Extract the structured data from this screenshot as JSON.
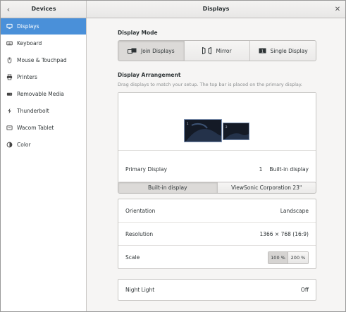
{
  "header": {
    "left_title": "Devices",
    "main_title": "Displays"
  },
  "sidebar": {
    "items": [
      {
        "label": "Displays",
        "icon": "display-icon",
        "active": true
      },
      {
        "label": "Keyboard",
        "icon": "keyboard-icon",
        "active": false
      },
      {
        "label": "Mouse & Touchpad",
        "icon": "mouse-icon",
        "active": false
      },
      {
        "label": "Printers",
        "icon": "printer-icon",
        "active": false
      },
      {
        "label": "Removable Media",
        "icon": "removable-media-icon",
        "active": false
      },
      {
        "label": "Thunderbolt",
        "icon": "thunderbolt-icon",
        "active": false
      },
      {
        "label": "Wacom Tablet",
        "icon": "tablet-icon",
        "active": false
      },
      {
        "label": "Color",
        "icon": "color-icon",
        "active": false
      }
    ]
  },
  "display_mode": {
    "title": "Display Mode",
    "options": [
      {
        "label": "Join Displays",
        "icon": "join-displays-icon",
        "active": true
      },
      {
        "label": "Mirror",
        "icon": "mirror-icon",
        "active": false
      },
      {
        "label": "Single Display",
        "icon": "single-display-icon",
        "active": false
      }
    ]
  },
  "arrangement": {
    "title": "Display Arrangement",
    "hint": "Drag displays to match your setup. The top bar is placed on the primary display.",
    "monitors": [
      {
        "number": "1"
      },
      {
        "number": "2"
      }
    ],
    "primary_label": "Primary Display",
    "primary_number": "1",
    "primary_value": "Built-in display"
  },
  "display_tabs": [
    {
      "label": "Built-in display",
      "active": true
    },
    {
      "label": "ViewSonic Corporation 23\"",
      "active": false
    }
  ],
  "settings": {
    "orientation_label": "Orientation",
    "orientation_value": "Landscape",
    "resolution_label": "Resolution",
    "resolution_value": "1366 × 768 (16:9)",
    "scale_label": "Scale",
    "scale_options": [
      "100 %",
      "200 %"
    ],
    "scale_selected": "100 %"
  },
  "night_light": {
    "label": "Night Light",
    "value": "Off"
  },
  "colors": {
    "accent": "#4a90d9",
    "monitor_bg": "#141a26"
  }
}
